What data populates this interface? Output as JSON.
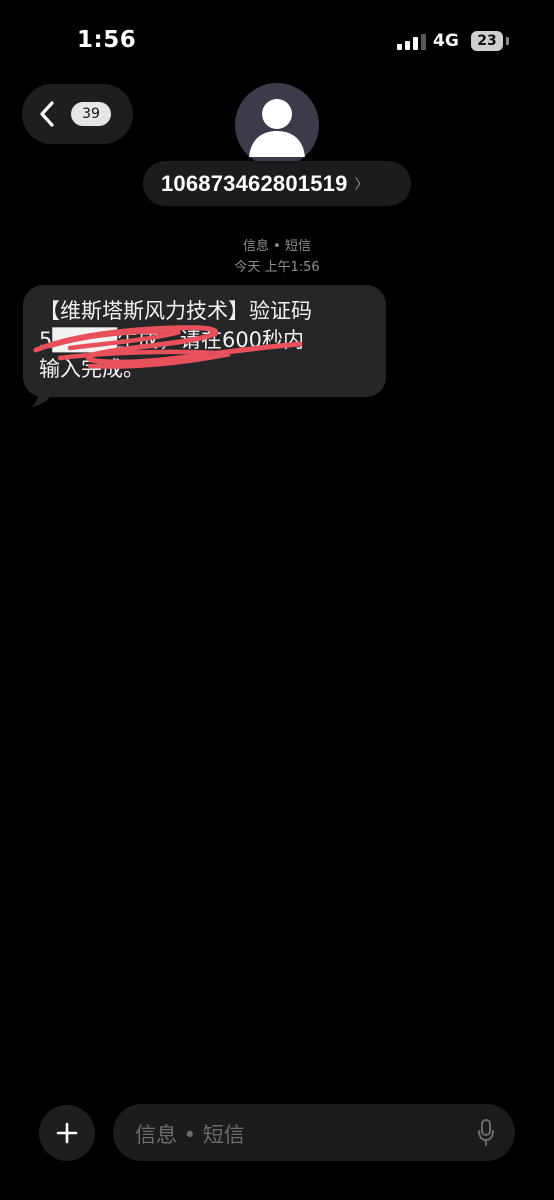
{
  "status_bar": {
    "time": "1:56",
    "network": "4G",
    "battery": "23",
    "signal_icon": "signal-bars-icon"
  },
  "header": {
    "unread_count": "39",
    "contact_number": "106873462801519",
    "contact_chevron": "〉",
    "avatar_icon": "person-avatar-icon"
  },
  "thread": {
    "service_label": "信息 • 短信",
    "timestamp": "今天 上午1:56",
    "messages": [
      {
        "lines": [
          "【维斯塔斯风力技术】验证码",
          "5████生成，请在600秒内",
          "输入完成。"
        ]
      }
    ]
  },
  "composer": {
    "placeholder": "信息 • 短信",
    "add_icon": "plus-icon",
    "mic_icon": "microphone-icon"
  },
  "colors": {
    "background": "#000000",
    "bubble": "#262629",
    "redaction_scribble": "#e8505b",
    "secondary_text": "#8e8e93"
  }
}
